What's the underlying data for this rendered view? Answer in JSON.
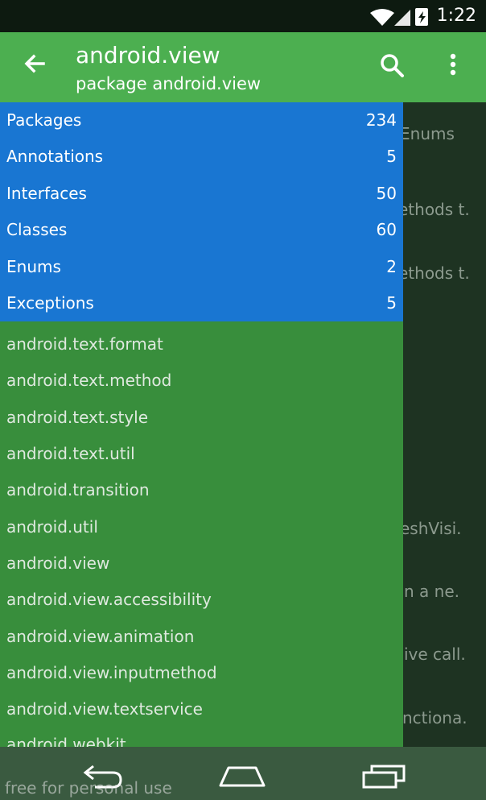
{
  "status": {
    "time": "1:22"
  },
  "appbar": {
    "title": "android.view",
    "subtitle": "package android.view"
  },
  "counts": [
    {
      "label": "Packages",
      "count": "234"
    },
    {
      "label": "Annotations",
      "count": "5"
    },
    {
      "label": "Interfaces",
      "count": "50"
    },
    {
      "label": "Classes",
      "count": "60"
    },
    {
      "label": "Enums",
      "count": "2"
    },
    {
      "label": "Exceptions",
      "count": "5"
    }
  ],
  "packages": [
    "android.text.format",
    "android.text.method",
    "android.text.style",
    "android.text.util",
    "android.transition",
    "android.util",
    "android.view",
    "android.view.accessibility",
    "android.view.animation",
    "android.view.inputmethod",
    "android.view.textservice",
    "android.webkit"
  ],
  "background_fragments": [
    "Enums",
    "ethods t.",
    "ethods t.",
    "eshVisi.",
    "n a ne.",
    "ive call.",
    "nctiona."
  ],
  "watermark": "free for personal use",
  "colors": {
    "appbar": "#4caf50",
    "counts_panel": "#1976d2",
    "package_panel": "#388e3c"
  }
}
